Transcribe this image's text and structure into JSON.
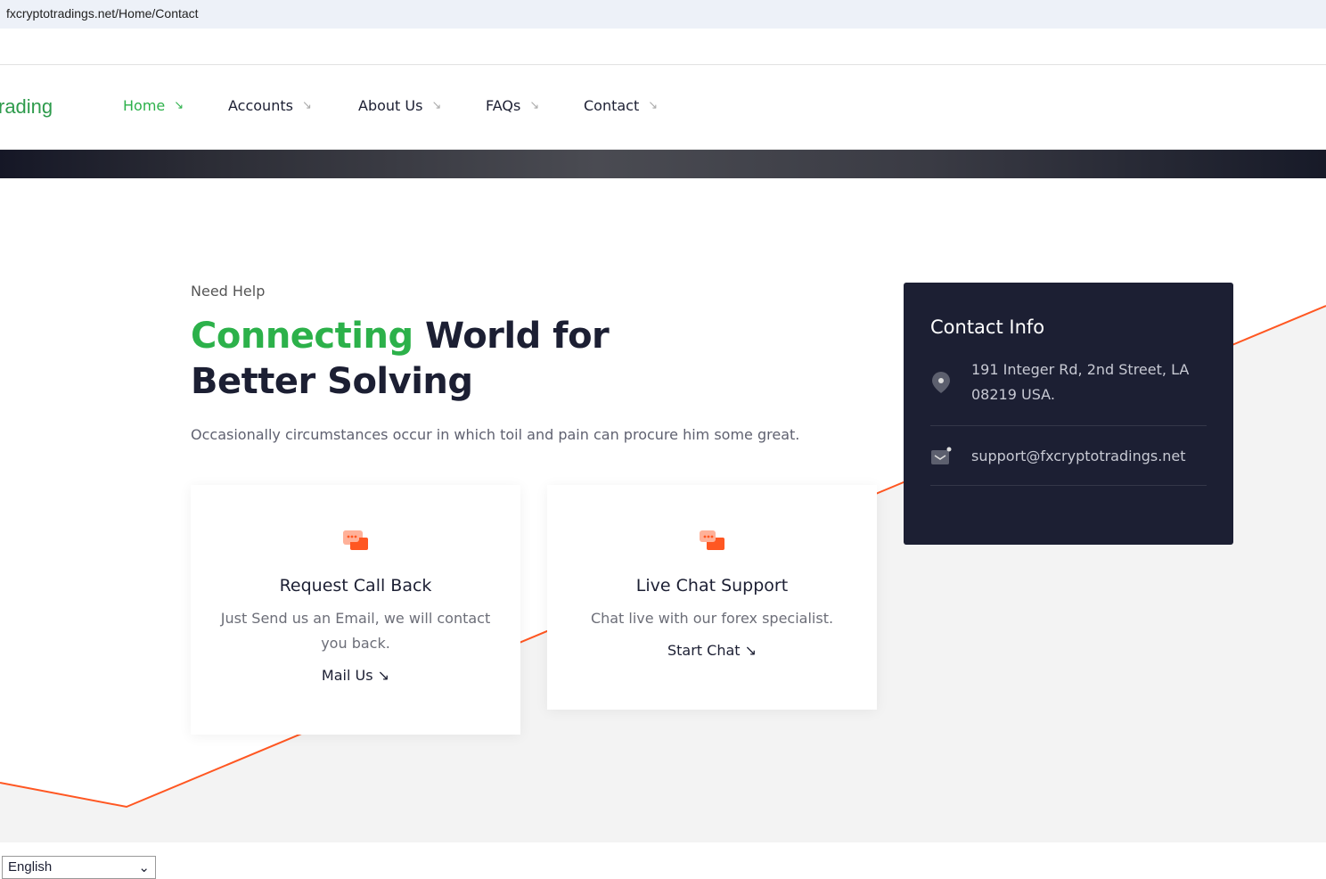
{
  "browser": {
    "url": "fxcryptotradings.net/Home/Contact"
  },
  "nav": {
    "logo": "rading",
    "items": [
      {
        "label": "Home"
      },
      {
        "label": "Accounts"
      },
      {
        "label": "About Us"
      },
      {
        "label": "FAQs"
      },
      {
        "label": "Contact"
      }
    ],
    "arrow": "↘"
  },
  "hero": {
    "eyebrow": "Need Help",
    "title_green": "Connecting",
    "title_rest": " World for",
    "title_line2": "Better Solving",
    "lead": "Occasionally circumstances occur in which toil and pain can procure him some great."
  },
  "cards": [
    {
      "title": "Request Call Back",
      "text": "Just Send us an Email, we will contact you back.",
      "link": "Mail Us"
    },
    {
      "title": "Live Chat Support",
      "text": "Chat live with our forex specialist.",
      "link": "Start Chat"
    }
  ],
  "contact_info": {
    "title": "Contact Info",
    "address": "191 Integer Rd, 2nd Street, LA 08219 USA.",
    "email": "support@fxcryptotradings.net"
  },
  "language": {
    "selected": "English"
  },
  "colors": {
    "green": "#2cb14a",
    "dark": "#1c1f33",
    "orange": "#ff5722"
  }
}
